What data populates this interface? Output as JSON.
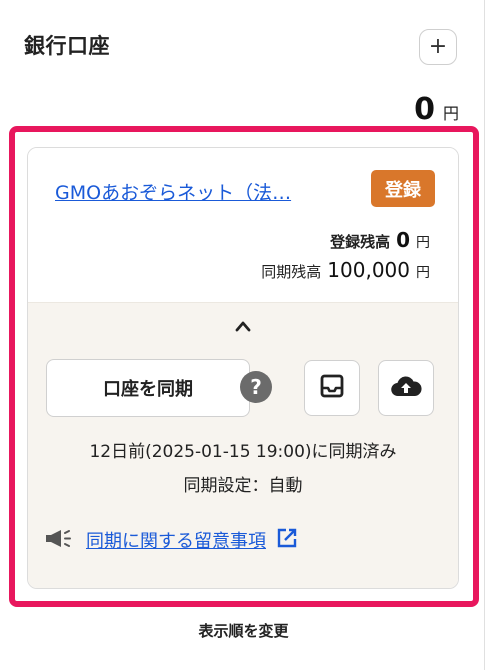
{
  "section": {
    "title": "銀行口座",
    "add_label": "+"
  },
  "total": {
    "amount": "0",
    "unit": "円"
  },
  "account": {
    "name": "GMOあおぞらネット（法…",
    "badge": "登録",
    "registered_balance_label": "登録残高",
    "registered_balance": "0",
    "registered_unit": "円",
    "synced_balance_label": "同期残高",
    "synced_balance": "100,000",
    "synced_unit": "円",
    "sync_button_label": "口座を同期",
    "help_label": "?",
    "sync_status": "12日前(2025-01-15 19:00)に同期済み",
    "sync_setting": "同期設定：自動",
    "notice_link": "同期に関する留意事項"
  },
  "footer": {
    "reorder_label": "表示順を変更"
  },
  "colors": {
    "highlight": "#e8175d",
    "badge": "#d9772b",
    "link": "#1a5ad8",
    "card_bottom": "#f7f4ef"
  },
  "icons": [
    "plus-icon",
    "chevron-up-icon",
    "help-icon",
    "inbox-icon",
    "cloud-upload-icon",
    "megaphone-icon",
    "external-link-icon"
  ]
}
